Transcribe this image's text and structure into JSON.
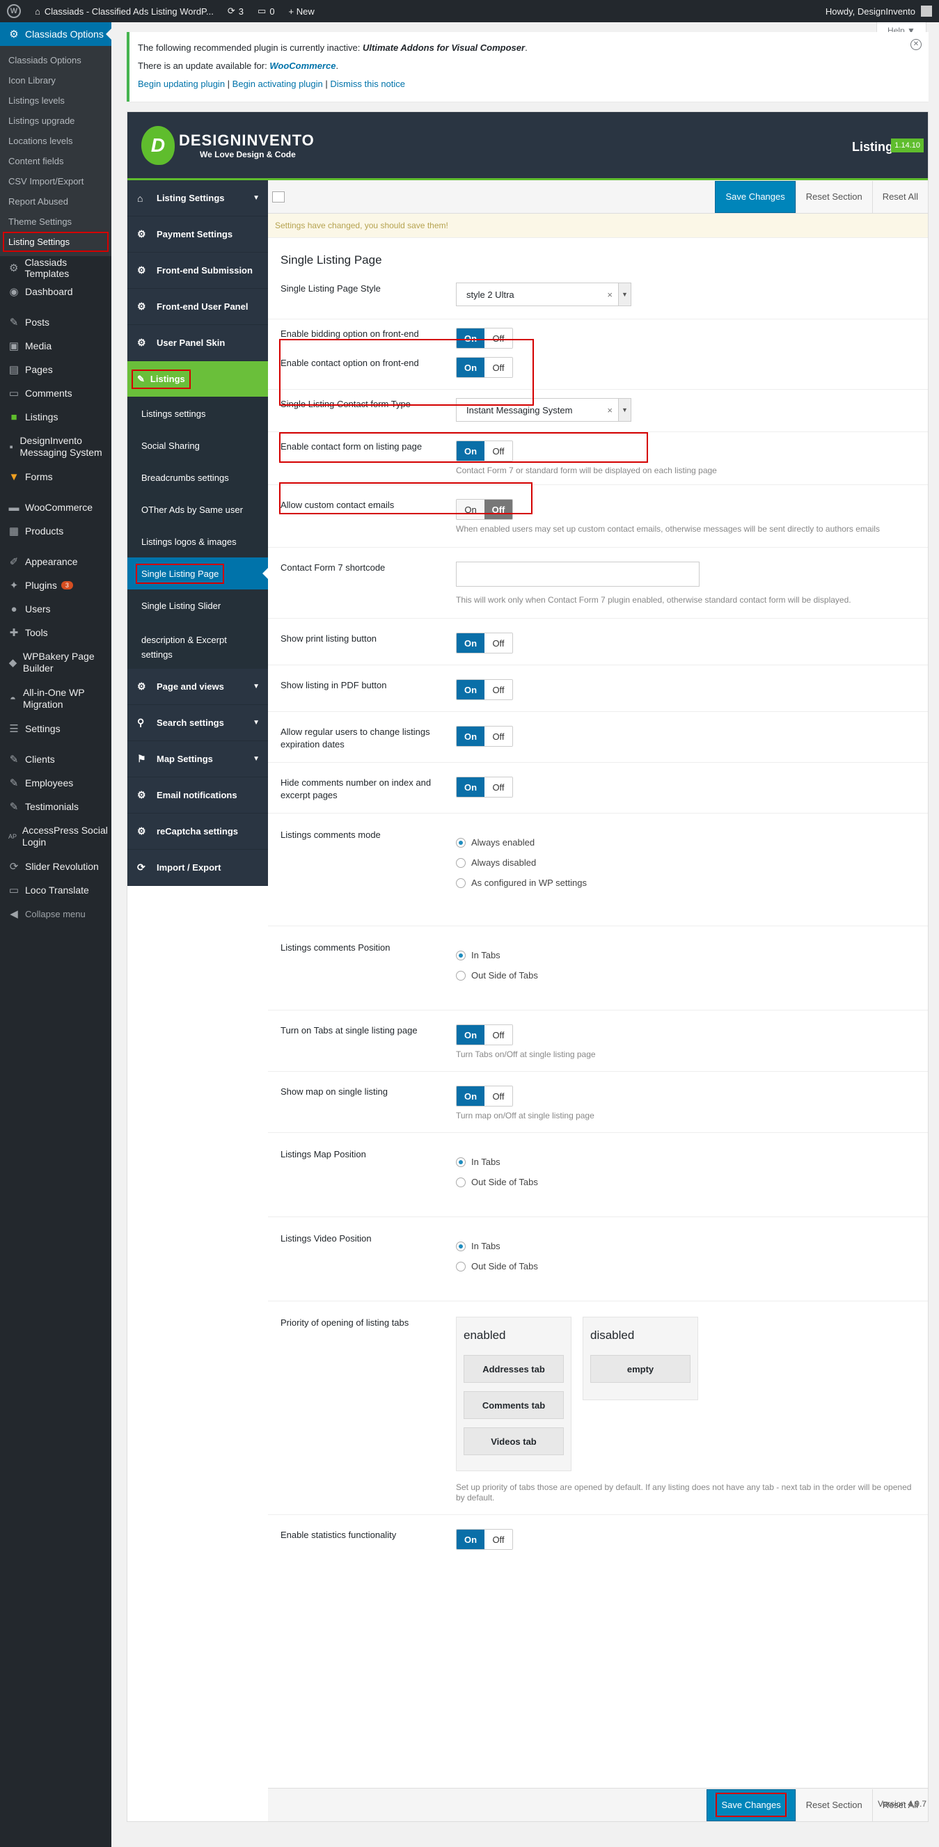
{
  "adminbar": {
    "site": "Classiads - Classified Ads Listing WordP...",
    "updates": "3",
    "comments": "0",
    "new": "+ New",
    "howdy": "Howdy, DesignInvento",
    "wp_icon": "wordpress-icon"
  },
  "help": "Help ▼",
  "menu": {
    "top_current": "Classiads Options",
    "sub": [
      "Classiads Options",
      "Icon Library",
      "Listings levels",
      "Listings upgrade",
      "Locations levels",
      "Content fields",
      "CSV Import/Export",
      "Report Abused",
      "Theme Settings",
      "Listing Settings"
    ],
    "items": [
      "Classiads Templates",
      "Dashboard",
      "Posts",
      "Media",
      "Pages",
      "Comments",
      "Listings",
      "DesignInvento Messaging System",
      "Forms",
      "WooCommerce",
      "Products",
      "Appearance",
      "Plugins",
      "Users",
      "Tools",
      "WPBakery Page Builder",
      "All-in-One WP Migration",
      "Settings",
      "Clients",
      "Employees",
      "Testimonials",
      "AccessPress Social Login",
      "Slider Revolution",
      "Loco Translate",
      "Collapse menu"
    ],
    "plugins_badge": "3"
  },
  "notice": {
    "line1_pre": "The following recommended plugin is currently inactive: ",
    "line1_plugin": "Ultimate Addons for Visual Composer",
    "line1_post": ".",
    "line2_pre": "There is an update available for: ",
    "line2_plugin": "WooCommerce",
    "line2_post": ".",
    "link1": "Begin updating plugin",
    "link2": "Begin activating plugin",
    "link3": "Dismiss this notice",
    "sep": " | "
  },
  "panel": {
    "brand": "DESIGNINVENTO",
    "tagline": "We Love Design & Code",
    "title": "Listing",
    "version": "1.14.10"
  },
  "nav": {
    "main": [
      {
        "label": "Listing Settings",
        "caret": true
      },
      {
        "label": "Payment Settings"
      },
      {
        "label": "Front-end Submission"
      },
      {
        "label": "Front-end User Panel"
      },
      {
        "label": "User Panel Skin"
      },
      {
        "label": "Listings"
      }
    ],
    "sub": [
      "Listings settings",
      "Social Sharing",
      "Breadcrumbs settings",
      "OTher Ads by Same user",
      "Listings logos & images",
      "Single Listing Page",
      "Single Listing Slider",
      "description & Excerpt",
      "settings"
    ],
    "after": [
      {
        "label": "Page and views"
      },
      {
        "label": "Search settings"
      },
      {
        "label": "Map Settings"
      },
      {
        "label": "Email notifications"
      },
      {
        "label": "reCaptcha settings"
      },
      {
        "label": "Import / Export"
      }
    ]
  },
  "toolbar": {
    "save": "Save Changes",
    "reset_section": "Reset Section",
    "reset_all": "Reset All"
  },
  "changed": "Settings have changed, you should save them!",
  "section_title": "Single Listing Page",
  "toggle": {
    "on": "On",
    "off": "Off"
  },
  "fields": {
    "style_label": "Single Listing Page Style",
    "style_value": "style 2 Ultra",
    "bidding_label": "Enable bidding option on front-end",
    "contact_opt_label": "Enable contact option on front-end",
    "contact_type_label": "Single Listing Contact form Type",
    "contact_type_value": "Instant Messaging System",
    "contact_form_label": "Enable contact form on listing page",
    "contact_form_desc": "Contact Form 7 or standard form will be displayed on each listing page",
    "custom_emails_label": "Allow custom contact emails",
    "custom_emails_desc": "When enabled users may set up custom contact emails, otherwise messages will be sent directly to authors emails",
    "cf7_label": "Contact Form 7 shortcode",
    "cf7_desc": "This will work only when Contact Form 7 plugin enabled, otherwise standard contact form will be displayed.",
    "print_label": "Show print listing button",
    "pdf_label": "Show listing in PDF button",
    "expiration_label": "Allow regular users to change listings expiration dates",
    "hide_comments_label": "Hide comments number on index and excerpt pages",
    "comments_mode_label": "Listings comments mode",
    "comments_mode_options": [
      "Always enabled",
      "Always disabled",
      "As configured in WP settings"
    ],
    "comments_pos_label": "Listings comments Position",
    "tabs_on_label": "Turn on Tabs at single listing page",
    "tabs_on_desc": "Turn Tabs on/Off at single listing page",
    "map_label": "Show map on single listing",
    "map_desc": "Turn map on/Off at single listing page",
    "map_pos_label": "Listings Map Position",
    "video_pos_label": "Listings Video Position",
    "pos_options": [
      "In Tabs",
      "Out Side of Tabs"
    ],
    "priority_label": "Priority of opening of listing tabs",
    "enabled": "enabled",
    "disabled": "disabled",
    "enabled_items": [
      "Addresses tab",
      "Comments tab",
      "Videos tab"
    ],
    "disabled_items": [
      "empty"
    ],
    "priority_desc": "Set up priority of tabs those are opened by default. If any listing does not have any tab - next tab in the order will be opened by default.",
    "stats_label": "Enable statistics functionality"
  },
  "wp_version": "Version 4.9.7"
}
